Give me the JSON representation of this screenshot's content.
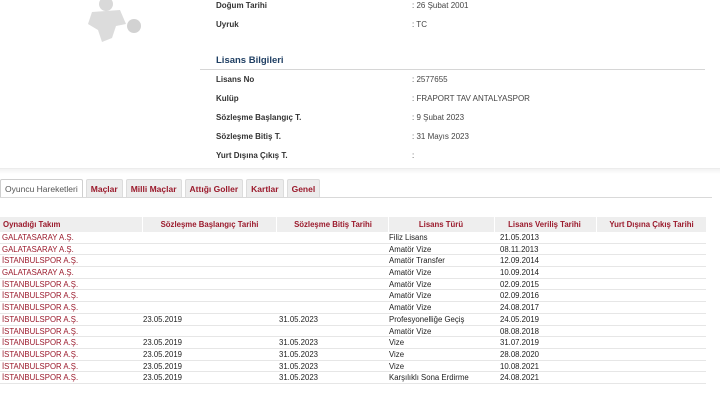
{
  "player_info": {
    "rows": [
      {
        "label": "Doğum Tarihi",
        "value": ": 26 Şubat 2001"
      },
      {
        "label": "Uyruk",
        "value": ": TC"
      }
    ]
  },
  "license_info": {
    "title": "Lisans Bilgileri",
    "rows": [
      {
        "label": "Lisans No",
        "value": ": 2577655"
      },
      {
        "label": "Kulüp",
        "value": ": FRAPORT TAV ANTALYASPOR"
      },
      {
        "label": "Sözleşme Başlangıç T.",
        "value": ": 9 Şubat 2023"
      },
      {
        "label": "Sözleşme Bitiş T.",
        "value": ": 31 Mayıs 2023"
      },
      {
        "label": "Yurt Dışına Çıkış T.",
        "value": ":"
      }
    ]
  },
  "tabs": [
    {
      "label": "Oyuncu Hareketleri",
      "active": true
    },
    {
      "label": "Maçlar",
      "active": false
    },
    {
      "label": "Milli Maçlar",
      "active": false
    },
    {
      "label": "Attığı Goller",
      "active": false
    },
    {
      "label": "Kartlar",
      "active": false
    },
    {
      "label": "Genel",
      "active": false
    }
  ],
  "table": {
    "headers": [
      "Oynadığı Takım",
      "Sözleşme Başlangıç Tarihi",
      "Sözleşme Bitiş Tarihi",
      "Lisans Türü",
      "Lisans Veriliş Tarihi",
      "Yurt Dışına Çıkış Tarihi"
    ],
    "rows": [
      [
        "GALATASARAY A.Ş.",
        "",
        "",
        "Filiz Lisans",
        "21.05.2013",
        ""
      ],
      [
        "GALATASARAY A.Ş.",
        "",
        "",
        "Amatör Vize",
        "08.11.2013",
        ""
      ],
      [
        "İSTANBULSPOR A.Ş.",
        "",
        "",
        "Amatör Transfer",
        "12.09.2014",
        ""
      ],
      [
        "GALATASARAY A.Ş.",
        "",
        "",
        "Amatör Vize",
        "10.09.2014",
        ""
      ],
      [
        "İSTANBULSPOR A.Ş.",
        "",
        "",
        "Amatör Vize",
        "02.09.2015",
        ""
      ],
      [
        "İSTANBULSPOR A.Ş.",
        "",
        "",
        "Amatör Vize",
        "02.09.2016",
        ""
      ],
      [
        "İSTANBULSPOR A.Ş.",
        "",
        "",
        "Amatör Vize",
        "24.08.2017",
        ""
      ],
      [
        "İSTANBULSPOR A.Ş.",
        "23.05.2019",
        "31.05.2023",
        "Profesyonelliğe Geçiş",
        "24.05.2019",
        ""
      ],
      [
        "İSTANBULSPOR A.Ş.",
        "",
        "",
        "Amatör Vize",
        "08.08.2018",
        ""
      ],
      [
        "İSTANBULSPOR A.Ş.",
        "23.05.2019",
        "31.05.2023",
        "Vize",
        "31.07.2019",
        ""
      ],
      [
        "İSTANBULSPOR A.Ş.",
        "23.05.2019",
        "31.05.2023",
        "Vize",
        "28.08.2020",
        ""
      ],
      [
        "İSTANBULSPOR A.Ş.",
        "23.05.2019",
        "31.05.2023",
        "Vize",
        "10.08.2021",
        ""
      ],
      [
        "İSTANBULSPOR A.Ş.",
        "23.05.2019",
        "31.05.2023",
        "Karşılıklı Sona Erdirme",
        "24.08.2021",
        ""
      ]
    ]
  }
}
